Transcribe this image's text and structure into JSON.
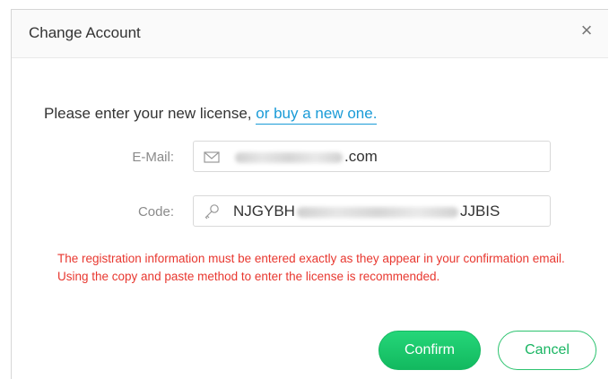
{
  "dialog": {
    "title": "Change Account",
    "close_glyph": "×"
  },
  "prompt": {
    "text": "Please enter your new license,",
    "link": "or buy a new one."
  },
  "email": {
    "label": "E-Mail:",
    "icon": "envelope-icon",
    "value_suffix": ".com"
  },
  "code": {
    "label": "Code:",
    "icon": "key-icon",
    "value_prefix": "NJGYBH",
    "value_suffix": "JJBIS"
  },
  "warning": "The registration information must be entered exactly as they appear in your confirmation email. Using the copy and paste method to enter the license is recommended.",
  "buttons": {
    "confirm": "Confirm",
    "cancel": "Cancel"
  },
  "colors": {
    "link": "#1a9bd7",
    "warning": "#e8372f",
    "accent": "#1ec46c"
  }
}
